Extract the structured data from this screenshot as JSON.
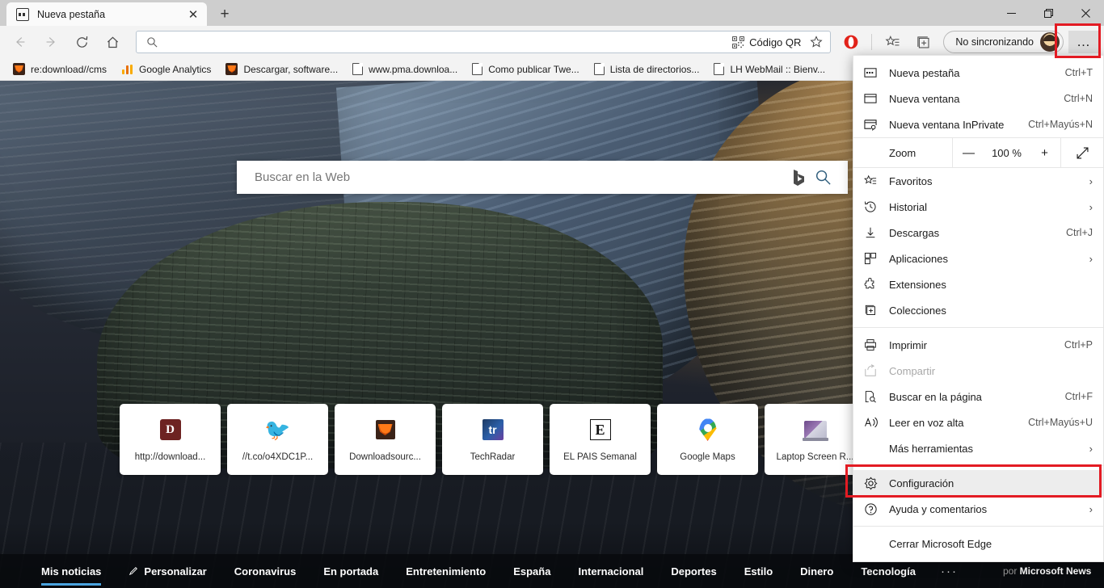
{
  "window": {
    "tab_title": "Nueva pestaña",
    "new_tab_button": "+",
    "minimize": "—",
    "maximize": "❐",
    "close": "✕",
    "tab_close": "✕"
  },
  "toolbar": {
    "back": "←",
    "forward": "→",
    "refresh": "⟳",
    "home": "⌂",
    "address_value": "",
    "qr_label": "Código QR",
    "favorite_star": "☆",
    "collections": "collections-icon",
    "profile_label": "No sincronizando",
    "menu": "…"
  },
  "bookmarks": [
    {
      "label": "re:download//cms",
      "icon": "firefox-icon"
    },
    {
      "label": "Google Analytics",
      "icon": "analytics-icon"
    },
    {
      "label": "Descargar, software...",
      "icon": "firefox-icon"
    },
    {
      "label": "www.pma.downloa...",
      "icon": "document-icon"
    },
    {
      "label": "Como publicar Twe...",
      "icon": "document-icon"
    },
    {
      "label": "Lista de directorios...",
      "icon": "document-icon"
    },
    {
      "label": "LH WebMail :: Bienv...",
      "icon": "document-icon"
    }
  ],
  "newtab": {
    "search_placeholder": "Buscar en la Web",
    "bing_icon": "bing-icon",
    "search_icon": "search-icon",
    "tiles": [
      {
        "label": "http://download...",
        "icon": "d-square-icon"
      },
      {
        "label": "//t.co/o4XDC1P...",
        "icon": "twitter-icon"
      },
      {
        "label": "Downloadsourc...",
        "icon": "firefox-icon"
      },
      {
        "label": "TechRadar",
        "icon": "techradar-icon"
      },
      {
        "label": "EL PAÍS Semanal",
        "icon": "elpais-icon"
      },
      {
        "label": "Google Maps",
        "icon": "google-maps-icon"
      },
      {
        "label": "Laptop Screen R...",
        "icon": "laptop-icon"
      }
    ]
  },
  "news": {
    "items": [
      {
        "label": "Mis noticias",
        "active": true,
        "pencil": false
      },
      {
        "label": "Personalizar",
        "active": false,
        "pencil": true
      },
      {
        "label": "Coronavirus",
        "active": false,
        "pencil": false
      },
      {
        "label": "En portada",
        "active": false,
        "pencil": false
      },
      {
        "label": "Entretenimiento",
        "active": false,
        "pencil": false
      },
      {
        "label": "España",
        "active": false,
        "pencil": false
      },
      {
        "label": "Internacional",
        "active": false,
        "pencil": false
      },
      {
        "label": "Deportes",
        "active": false,
        "pencil": false
      },
      {
        "label": "Estilo",
        "active": false,
        "pencil": false
      },
      {
        "label": "Dinero",
        "active": false,
        "pencil": false
      },
      {
        "label": "Tecnología",
        "active": false,
        "pencil": false
      }
    ],
    "more": "···",
    "by_prefix": "por ",
    "by_brand": "Microsoft News"
  },
  "menu": {
    "items": [
      {
        "label": "Nueva pestaña",
        "accel": "Ctrl+T",
        "icon": "new-tab-icon",
        "chevron": false
      },
      {
        "label": "Nueva ventana",
        "accel": "Ctrl+N",
        "icon": "new-window-icon",
        "chevron": false
      },
      {
        "label": "Nueva ventana InPrivate",
        "accel": "Ctrl+Mayús+N",
        "icon": "inprivate-icon",
        "chevron": false
      }
    ],
    "zoom": {
      "label": "Zoom",
      "minus": "—",
      "value": "100 %",
      "plus": "+",
      "fullscreen": "⤢"
    },
    "group2": [
      {
        "label": "Favoritos",
        "accel": "",
        "icon": "favorites-icon",
        "chevron": true
      },
      {
        "label": "Historial",
        "accel": "",
        "icon": "history-icon",
        "chevron": true
      },
      {
        "label": "Descargas",
        "accel": "Ctrl+J",
        "icon": "downloads-icon",
        "chevron": false
      },
      {
        "label": "Aplicaciones",
        "accel": "",
        "icon": "apps-icon",
        "chevron": true
      },
      {
        "label": "Extensiones",
        "accel": "",
        "icon": "extensions-icon",
        "chevron": false
      },
      {
        "label": "Colecciones",
        "accel": "",
        "icon": "collections-icon",
        "chevron": false
      }
    ],
    "group3": [
      {
        "label": "Imprimir",
        "accel": "Ctrl+P",
        "icon": "print-icon",
        "chevron": false,
        "disabled": false
      },
      {
        "label": "Compartir",
        "accel": "",
        "icon": "share-icon",
        "chevron": false,
        "disabled": true
      },
      {
        "label": "Buscar en la página",
        "accel": "Ctrl+F",
        "icon": "find-icon",
        "chevron": false,
        "disabled": false
      },
      {
        "label": "Leer en voz alta",
        "accel": "Ctrl+Mayús+U",
        "icon": "read-aloud-icon",
        "chevron": false,
        "disabled": false
      },
      {
        "label": "Más herramientas",
        "accel": "",
        "icon": "",
        "chevron": true,
        "disabled": false
      }
    ],
    "settings": {
      "label": "Configuración",
      "accel": "",
      "icon": "gear-icon",
      "chevron": false
    },
    "help": {
      "label": "Ayuda y comentarios",
      "accel": "",
      "icon": "help-icon",
      "chevron": true
    },
    "close_edge": {
      "label": "Cerrar Microsoft Edge",
      "accel": "",
      "icon": "",
      "chevron": false
    }
  },
  "highlight_color": "#e31b23"
}
